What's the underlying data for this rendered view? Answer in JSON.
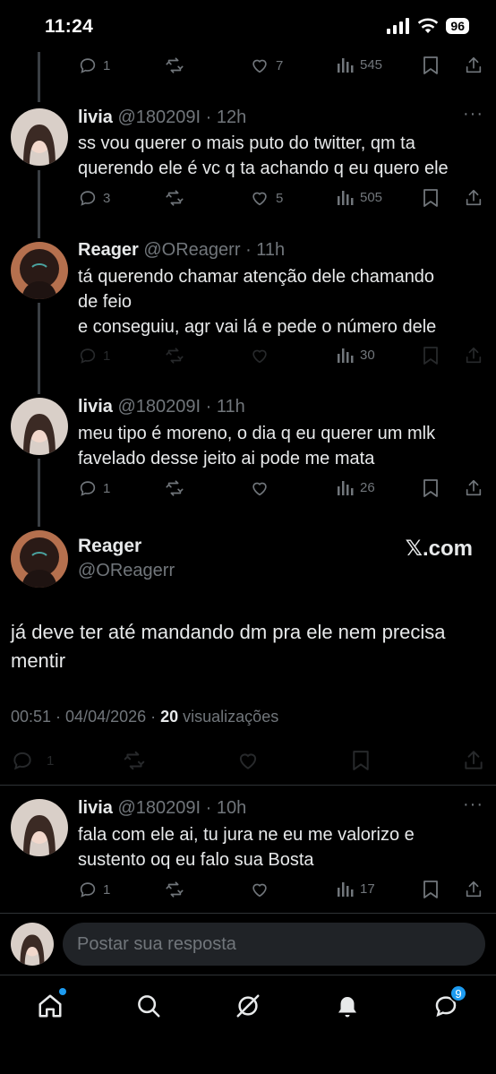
{
  "status_bar": {
    "time": "11:24",
    "battery": "96"
  },
  "top_actions": {
    "replies": "1",
    "likes": "7",
    "views": "545"
  },
  "posts": [
    {
      "name": "livia",
      "handle": "@180209I",
      "time": "12h",
      "lines": [
        "ss vou querer o mais puto do twitter, qm ta",
        "querendo ele é vc q ta achando q eu quero ele"
      ],
      "replies": "3",
      "likes": "5",
      "views": "505"
    },
    {
      "name": "Reager",
      "handle": "@OReagerr",
      "time": "11h",
      "lines": [
        "tá querendo chamar atenção dele chamando",
        "de feio",
        "e conseguiu, agr vai lá e pede o número dele"
      ],
      "replies": "1",
      "likes": "",
      "views": "30"
    },
    {
      "name": "livia",
      "handle": "@180209I",
      "time": "11h",
      "lines": [
        "meu tipo é moreno, o dia q eu querer um mlk",
        "favelado desse jeito ai pode me mata"
      ],
      "replies": "1",
      "likes": "",
      "views": "26"
    }
  ],
  "main_post": {
    "name": "Reager",
    "handle": "@OReagerr",
    "brand": "𝕏.com",
    "text": "já deve ter até mandando dm pra ele nem precisa mentir",
    "timestamp": "00:51 · 04/04/2026 · ",
    "views_count": "20",
    "views_label": " visualizações",
    "replies": "1"
  },
  "last_post": {
    "name": "livia",
    "handle": "@180209I",
    "time": "10h",
    "lines": [
      "fala com ele ai, tu jura ne eu me valorizo e",
      "sustento oq eu falo sua Bosta"
    ],
    "replies": "1",
    "likes": "",
    "views": "17"
  },
  "reply_bar": {
    "placeholder": "Postar sua resposta"
  },
  "nav": {
    "messages_badge": "9"
  },
  "colors": {
    "background": "#000000",
    "text": "#e7e9ea",
    "muted": "#71767b",
    "accent": "#1d9bf0"
  }
}
